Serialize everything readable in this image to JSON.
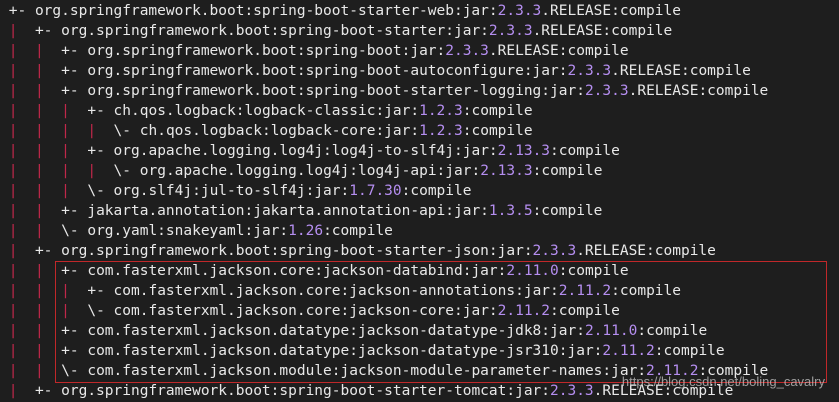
{
  "tree": {
    "lines": [
      {
        "prefix": "+- ",
        "bars": [],
        "text_before": "org.springframework.boot:spring-boot-starter-web:jar:",
        "version": "2.3.3",
        "text_after": ".RELEASE:compile"
      },
      {
        "prefix": "+- ",
        "bars": [
          2
        ],
        "text_before": "org.springframework.boot:spring-boot-starter:jar:",
        "version": "2.3.3",
        "text_after": ".RELEASE:compile"
      },
      {
        "prefix": "+- ",
        "bars": [
          2,
          5
        ],
        "text_before": "org.springframework.boot:spring-boot:jar:",
        "version": "2.3.3",
        "text_after": ".RELEASE:compile"
      },
      {
        "prefix": "+- ",
        "bars": [
          2,
          5
        ],
        "text_before": "org.springframework.boot:spring-boot-autoconfigure:jar:",
        "version": "2.3.3",
        "text_after": ".RELEASE:compile"
      },
      {
        "prefix": "+- ",
        "bars": [
          2,
          5
        ],
        "text_before": "org.springframework.boot:spring-boot-starter-logging:jar:",
        "version": "2.3.3",
        "text_after": ".RELEASE:compile"
      },
      {
        "prefix": "+- ",
        "bars": [
          2,
          5,
          8
        ],
        "text_before": "ch.qos.logback:logback-classic:jar:",
        "version": "1.2.3",
        "text_after": ":compile"
      },
      {
        "prefix": "\\- ",
        "bars": [
          2,
          5,
          8,
          11
        ],
        "text_before": "ch.qos.logback:logback-core:jar:",
        "version": "1.2.3",
        "text_after": ":compile"
      },
      {
        "prefix": "+- ",
        "bars": [
          2,
          5,
          8
        ],
        "text_before": "org.apache.logging.log4j:log4j-to-slf4j:jar:",
        "version": "2.13.3",
        "text_after": ":compile"
      },
      {
        "prefix": "\\- ",
        "bars": [
          2,
          5,
          8,
          11
        ],
        "text_before": "org.apache.logging.log4j:log4j-api:jar:",
        "version": "2.13.3",
        "text_after": ":compile"
      },
      {
        "prefix": "\\- ",
        "bars": [
          2,
          5,
          8
        ],
        "text_before": "org.slf4j:jul-to-slf4j:jar:",
        "version": "1.7.30",
        "text_after": ":compile"
      },
      {
        "prefix": "+- ",
        "bars": [
          2,
          5
        ],
        "text_before": "jakarta.annotation:jakarta.annotation-api:jar:",
        "version": "1.3.5",
        "text_after": ":compile"
      },
      {
        "prefix": "\\- ",
        "bars": [
          2,
          5
        ],
        "text_before": "org.yaml:snakeyaml:jar:",
        "version": "1.26",
        "text_after": ":compile"
      },
      {
        "prefix": "+- ",
        "bars": [
          2
        ],
        "text_before": "org.springframework.boot:spring-boot-starter-json:jar:",
        "version": "2.3.3",
        "text_after": ".RELEASE:compile"
      },
      {
        "prefix": "+- ",
        "bars": [
          2,
          5
        ],
        "text_before": "com.fasterxml.jackson.core:jackson-databind:jar:",
        "version": "2.11.0",
        "text_after": ":compile"
      },
      {
        "prefix": "+- ",
        "bars": [
          2,
          5,
          8
        ],
        "text_before": "com.fasterxml.jackson.core:jackson-annotations:jar:",
        "version": "2.11.2",
        "text_after": ":compile"
      },
      {
        "prefix": "\\- ",
        "bars": [
          2,
          5,
          8
        ],
        "text_before": "com.fasterxml.jackson.core:jackson-core:jar:",
        "version": "2.11.2",
        "text_after": ":compile"
      },
      {
        "prefix": "+- ",
        "bars": [
          2,
          5
        ],
        "text_before": "com.fasterxml.jackson.datatype:jackson-datatype-jdk8:jar:",
        "version": "2.11.0",
        "text_after": ":compile"
      },
      {
        "prefix": "+- ",
        "bars": [
          2,
          5
        ],
        "text_before": "com.fasterxml.jackson.datatype:jackson-datatype-jsr310:jar:",
        "version": "2.11.2",
        "text_after": ":compile"
      },
      {
        "prefix": "\\- ",
        "bars": [
          2,
          5
        ],
        "text_before": "com.fasterxml.jackson.module:jackson-module-parameter-names:jar:",
        "version": "2.11.2",
        "text_after": ":compile"
      },
      {
        "prefix": "+- ",
        "bars": [
          2
        ],
        "text_before": "org.springframework.boot:spring-boot-starter-tomcat:jar:",
        "version": "2.3.3",
        "text_after": ".RELEASE:compile"
      }
    ]
  },
  "watermark": "https://blog.csdn.net/boling_cavalry",
  "colors": {
    "background": "#1e1e1e",
    "text": "#e8e8e8",
    "tree_bar": "#c0284a",
    "version": "#b58ef0",
    "highlight_border": "#c0282a"
  }
}
